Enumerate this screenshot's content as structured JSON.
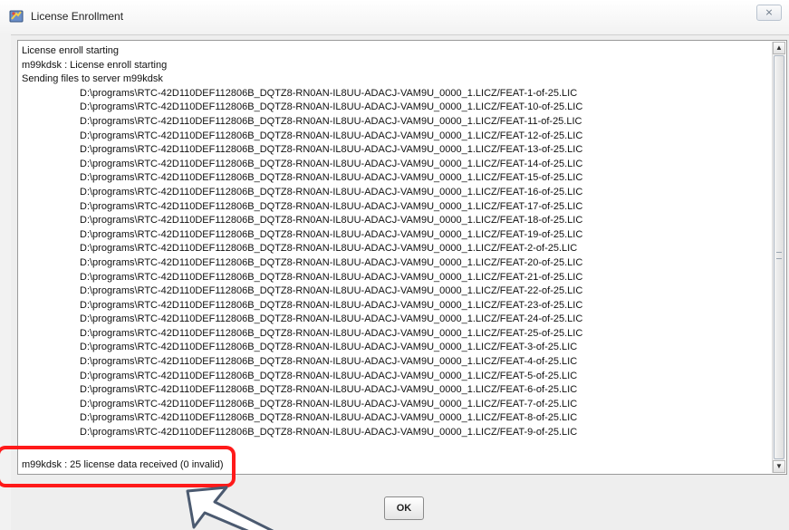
{
  "window": {
    "title": "License Enrollment",
    "close_glyph": "⨯",
    "icon": "app-tools-icon"
  },
  "log": {
    "header_lines": [
      "License enroll starting",
      "m99kdsk : License enroll starting",
      "Sending files to server m99kdsk"
    ],
    "file_lines": [
      "D:\\programs\\RTC-42D110DEF112806B_DQTZ8-RN0AN-IL8UU-ADACJ-VAM9U_0000_1.LICZ/FEAT-1-of-25.LIC",
      "D:\\programs\\RTC-42D110DEF112806B_DQTZ8-RN0AN-IL8UU-ADACJ-VAM9U_0000_1.LICZ/FEAT-10-of-25.LIC",
      "D:\\programs\\RTC-42D110DEF112806B_DQTZ8-RN0AN-IL8UU-ADACJ-VAM9U_0000_1.LICZ/FEAT-11-of-25.LIC",
      "D:\\programs\\RTC-42D110DEF112806B_DQTZ8-RN0AN-IL8UU-ADACJ-VAM9U_0000_1.LICZ/FEAT-12-of-25.LIC",
      "D:\\programs\\RTC-42D110DEF112806B_DQTZ8-RN0AN-IL8UU-ADACJ-VAM9U_0000_1.LICZ/FEAT-13-of-25.LIC",
      "D:\\programs\\RTC-42D110DEF112806B_DQTZ8-RN0AN-IL8UU-ADACJ-VAM9U_0000_1.LICZ/FEAT-14-of-25.LIC",
      "D:\\programs\\RTC-42D110DEF112806B_DQTZ8-RN0AN-IL8UU-ADACJ-VAM9U_0000_1.LICZ/FEAT-15-of-25.LIC",
      "D:\\programs\\RTC-42D110DEF112806B_DQTZ8-RN0AN-IL8UU-ADACJ-VAM9U_0000_1.LICZ/FEAT-16-of-25.LIC",
      "D:\\programs\\RTC-42D110DEF112806B_DQTZ8-RN0AN-IL8UU-ADACJ-VAM9U_0000_1.LICZ/FEAT-17-of-25.LIC",
      "D:\\programs\\RTC-42D110DEF112806B_DQTZ8-RN0AN-IL8UU-ADACJ-VAM9U_0000_1.LICZ/FEAT-18-of-25.LIC",
      "D:\\programs\\RTC-42D110DEF112806B_DQTZ8-RN0AN-IL8UU-ADACJ-VAM9U_0000_1.LICZ/FEAT-19-of-25.LIC",
      "D:\\programs\\RTC-42D110DEF112806B_DQTZ8-RN0AN-IL8UU-ADACJ-VAM9U_0000_1.LICZ/FEAT-2-of-25.LIC",
      "D:\\programs\\RTC-42D110DEF112806B_DQTZ8-RN0AN-IL8UU-ADACJ-VAM9U_0000_1.LICZ/FEAT-20-of-25.LIC",
      "D:\\programs\\RTC-42D110DEF112806B_DQTZ8-RN0AN-IL8UU-ADACJ-VAM9U_0000_1.LICZ/FEAT-21-of-25.LIC",
      "D:\\programs\\RTC-42D110DEF112806B_DQTZ8-RN0AN-IL8UU-ADACJ-VAM9U_0000_1.LICZ/FEAT-22-of-25.LIC",
      "D:\\programs\\RTC-42D110DEF112806B_DQTZ8-RN0AN-IL8UU-ADACJ-VAM9U_0000_1.LICZ/FEAT-23-of-25.LIC",
      "D:\\programs\\RTC-42D110DEF112806B_DQTZ8-RN0AN-IL8UU-ADACJ-VAM9U_0000_1.LICZ/FEAT-24-of-25.LIC",
      "D:\\programs\\RTC-42D110DEF112806B_DQTZ8-RN0AN-IL8UU-ADACJ-VAM9U_0000_1.LICZ/FEAT-25-of-25.LIC",
      "D:\\programs\\RTC-42D110DEF112806B_DQTZ8-RN0AN-IL8UU-ADACJ-VAM9U_0000_1.LICZ/FEAT-3-of-25.LIC",
      "D:\\programs\\RTC-42D110DEF112806B_DQTZ8-RN0AN-IL8UU-ADACJ-VAM9U_0000_1.LICZ/FEAT-4-of-25.LIC",
      "D:\\programs\\RTC-42D110DEF112806B_DQTZ8-RN0AN-IL8UU-ADACJ-VAM9U_0000_1.LICZ/FEAT-5-of-25.LIC",
      "D:\\programs\\RTC-42D110DEF112806B_DQTZ8-RN0AN-IL8UU-ADACJ-VAM9U_0000_1.LICZ/FEAT-6-of-25.LIC",
      "D:\\programs\\RTC-42D110DEF112806B_DQTZ8-RN0AN-IL8UU-ADACJ-VAM9U_0000_1.LICZ/FEAT-7-of-25.LIC",
      "D:\\programs\\RTC-42D110DEF112806B_DQTZ8-RN0AN-IL8UU-ADACJ-VAM9U_0000_1.LICZ/FEAT-8-of-25.LIC",
      "D:\\programs\\RTC-42D110DEF112806B_DQTZ8-RN0AN-IL8UU-ADACJ-VAM9U_0000_1.LICZ/FEAT-9-of-25.LIC"
    ],
    "final_line": "m99kdsk : 25 license data received (0 invalid)"
  },
  "scrollbar": {
    "up_glyph": "▲",
    "down_glyph": "▼"
  },
  "buttons": {
    "ok_label": "OK"
  },
  "colors": {
    "highlight": "#ff1a1a",
    "arrow_fill": "#ffffff",
    "arrow_stroke": "#4b5a70"
  }
}
